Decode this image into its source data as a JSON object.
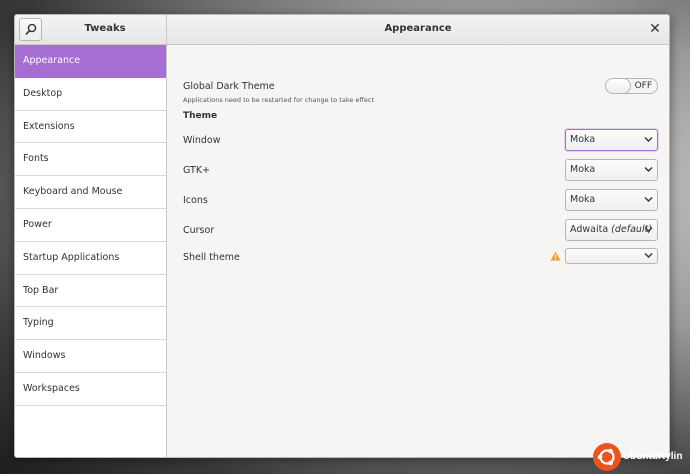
{
  "titlebar": {
    "app_title": "Tweaks",
    "page_title": "Appearance",
    "close_glyph": "✕"
  },
  "sidebar": {
    "items": [
      {
        "label": "Appearance",
        "active": true
      },
      {
        "label": "Desktop"
      },
      {
        "label": "Extensions"
      },
      {
        "label": "Fonts"
      },
      {
        "label": "Keyboard and Mouse"
      },
      {
        "label": "Power"
      },
      {
        "label": "Startup Applications"
      },
      {
        "label": "Top Bar"
      },
      {
        "label": "Typing"
      },
      {
        "label": "Windows"
      },
      {
        "label": "Workspaces"
      }
    ]
  },
  "content": {
    "global_dark": {
      "label": "Global Dark Theme",
      "note": "Applications need to be restarted for change to take effect",
      "switch_state": "OFF"
    },
    "theme_heading": "Theme",
    "rows": {
      "window": {
        "label": "Window",
        "value": "Moka"
      },
      "gtk": {
        "label": "GTK+",
        "value": "Moka"
      },
      "icons": {
        "label": "Icons",
        "value": "Moka"
      },
      "cursor": {
        "label": "Cursor",
        "value": "Adwaita",
        "suffix": "(default)"
      },
      "shell": {
        "label": "Shell theme",
        "value": ""
      }
    }
  },
  "watermark": {
    "text": "UbuntuKylin"
  },
  "colors": {
    "accent": "#a66dd3",
    "warning": "#f0a030",
    "watermark": "#e95420"
  },
  "icons": {
    "search": "search-icon",
    "warning": "warning-icon",
    "dropdown": "chevron-down-icon"
  }
}
